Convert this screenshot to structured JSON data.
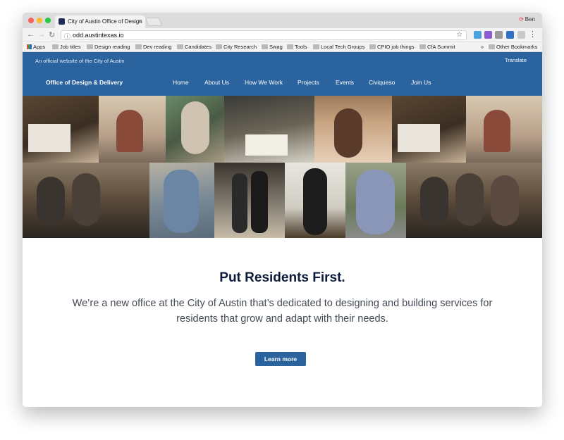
{
  "browser": {
    "tab_title": "City of Austin Office of Design",
    "profile_name": "Ben",
    "url": "odd.austintexas.io",
    "bookmarks": [
      "Apps",
      "Job titles",
      "Design reading",
      "Dev reading",
      "Candidates",
      "City Research",
      "Swag",
      "Tools",
      "Local Tech Groups",
      "CPIO job things",
      "CfA Summit"
    ],
    "other_bookmarks": "Other Bookmarks",
    "overflow": "»"
  },
  "site": {
    "official_banner": "An official website of the City of Austin",
    "translate": "Translate",
    "brand": "Office of Design & Delivery",
    "nav": [
      "Home",
      "About Us",
      "How We Work",
      "Projects",
      "Events",
      "Civiqueso",
      "Join Us"
    ]
  },
  "hero": {
    "title": "Put Residents First.",
    "text": "We’re a new office at the City of Austin that’s dedicated to designing and building services for residents that grow and adapt with their needs.",
    "cta": "Learn more"
  },
  "colors": {
    "brand_blue": "#2b639e",
    "title_navy": "#0d1b3a"
  }
}
